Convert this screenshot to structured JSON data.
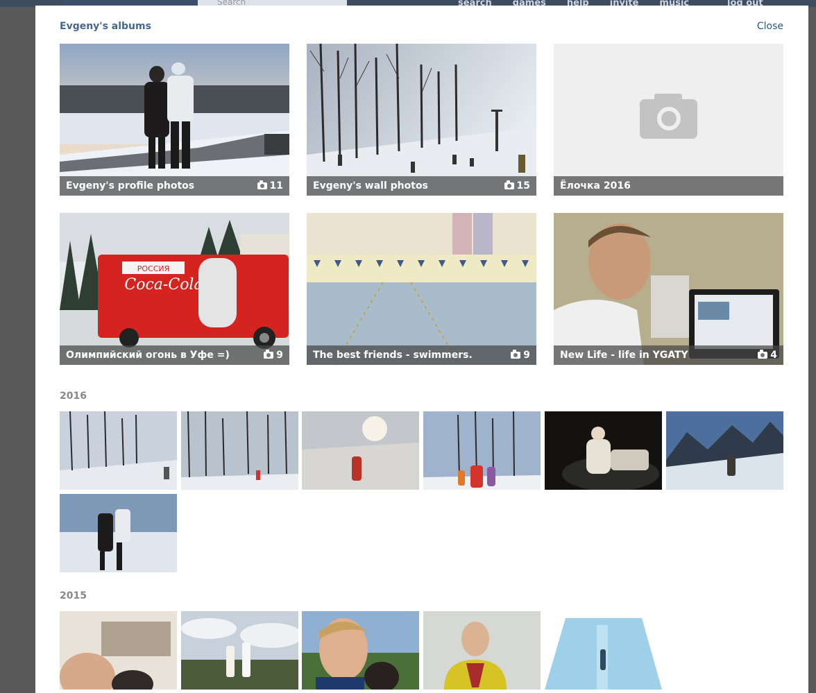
{
  "background": {
    "search_placeholder": "Search",
    "nav": [
      "search",
      "games",
      "help",
      "invite",
      "music"
    ],
    "logout": "log out"
  },
  "modal": {
    "title": "Evgeny's albums",
    "close_label": "Close"
  },
  "albums": [
    {
      "title": "Evgeny's profile photos",
      "count": "11"
    },
    {
      "title": "Evgeny's wall photos",
      "count": "15"
    },
    {
      "title": "Ёлочка 2016",
      "count": ""
    },
    {
      "title": "Олимпийский огонь в Уфе =)",
      "count": "9"
    },
    {
      "title": "The best friends - swimmers.",
      "count": "9"
    },
    {
      "title": "New Life - life in YGATY",
      "count": "4"
    }
  ],
  "years": [
    "2016",
    "2015"
  ],
  "colors": {
    "title": "#45688e",
    "link": "#2b587a",
    "caption_bg": "rgba(70,70,70,0.72)",
    "year": "#888888"
  }
}
